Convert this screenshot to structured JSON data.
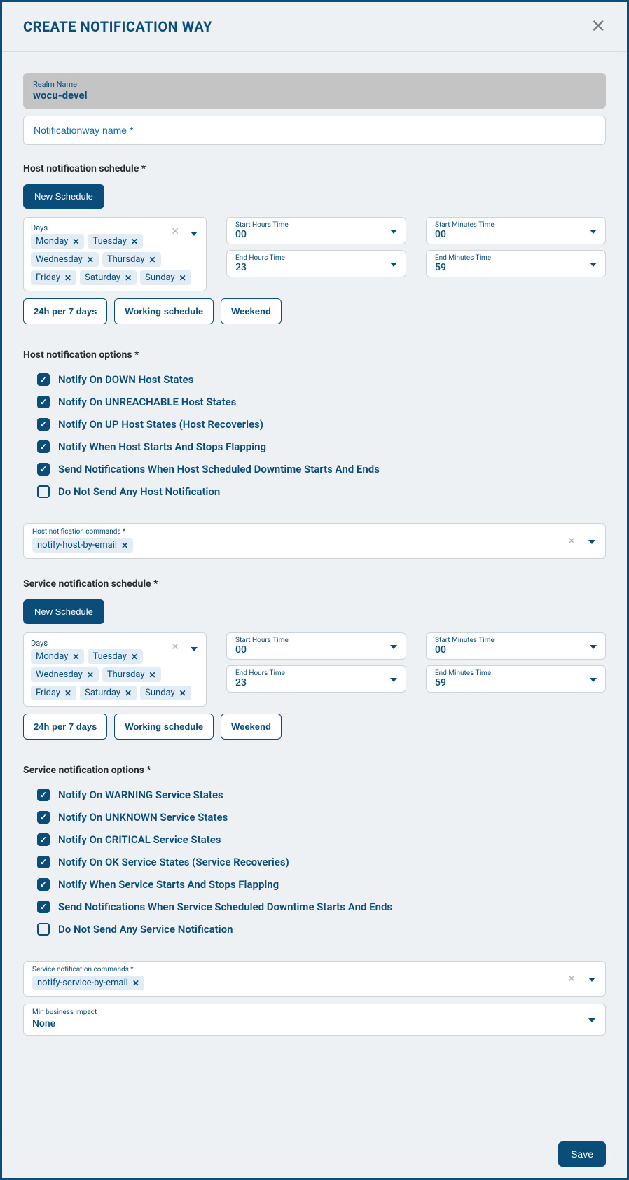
{
  "modal": {
    "title": "CREATE NOTIFICATION WAY",
    "realm_label": "Realm Name",
    "realm_value": "wocu-devel",
    "name_placeholder": "Notificationway name *"
  },
  "host": {
    "schedule_label": "Host notification schedule *",
    "new_schedule_btn": "New Schedule",
    "days_label": "Days",
    "days": [
      "Monday",
      "Tuesday",
      "Wednesday",
      "Thursday",
      "Friday",
      "Saturday",
      "Sunday"
    ],
    "start_hours_label": "Start Hours Time",
    "start_hours_value": "00",
    "start_minutes_label": "Start Minutes Time",
    "start_minutes_value": "00",
    "end_hours_label": "End Hours Time",
    "end_hours_value": "23",
    "end_minutes_label": "End Minutes Time",
    "end_minutes_value": "59",
    "presets": [
      "24h per 7 days",
      "Working schedule",
      "Weekend"
    ],
    "options_label": "Host notification options *",
    "options": [
      {
        "label": "Notify On DOWN Host States",
        "checked": true
      },
      {
        "label": "Notify On UNREACHABLE Host States",
        "checked": true
      },
      {
        "label": "Notify On UP Host States (Host Recoveries)",
        "checked": true
      },
      {
        "label": "Notify When Host Starts And Stops Flapping",
        "checked": true
      },
      {
        "label": "Send Notifications When Host Scheduled Downtime Starts And Ends",
        "checked": true
      },
      {
        "label": "Do Not Send Any Host Notification",
        "checked": false
      }
    ],
    "commands_label": "Host notification commands *",
    "commands": [
      "notify-host-by-email"
    ]
  },
  "service": {
    "schedule_label": "Service notification schedule *",
    "new_schedule_btn": "New Schedule",
    "days_label": "Days",
    "days": [
      "Monday",
      "Tuesday",
      "Wednesday",
      "Thursday",
      "Friday",
      "Saturday",
      "Sunday"
    ],
    "start_hours_label": "Start Hours Time",
    "start_hours_value": "00",
    "start_minutes_label": "Start Minutes Time",
    "start_minutes_value": "00",
    "end_hours_label": "End Hours Time",
    "end_hours_value": "23",
    "end_minutes_label": "End Minutes Time",
    "end_minutes_value": "59",
    "presets": [
      "24h per 7 days",
      "Working schedule",
      "Weekend"
    ],
    "options_label": "Service notification options *",
    "options": [
      {
        "label": "Notify On WARNING Service States",
        "checked": true
      },
      {
        "label": "Notify On UNKNOWN Service States",
        "checked": true
      },
      {
        "label": "Notify On CRITICAL Service States",
        "checked": true
      },
      {
        "label": "Notify On OK Service States (Service Recoveries)",
        "checked": true
      },
      {
        "label": "Notify When Service Starts And Stops Flapping",
        "checked": true
      },
      {
        "label": "Send Notifications When Service Scheduled Downtime Starts And Ends",
        "checked": true
      },
      {
        "label": "Do Not Send Any Service Notification",
        "checked": false
      }
    ],
    "commands_label": "Service notification commands *",
    "commands": [
      "notify-service-by-email"
    ]
  },
  "impact": {
    "label": "Min business impact",
    "value": "None"
  },
  "footer": {
    "save_label": "Save"
  }
}
